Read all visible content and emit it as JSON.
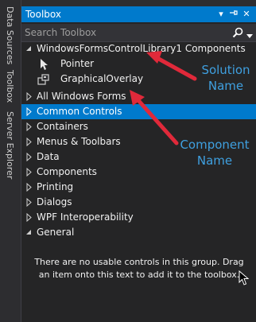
{
  "side_tabs": [
    "Data Sources",
    "Toolbox",
    "Server Explorer"
  ],
  "toolbox": {
    "title": "Toolbox",
    "search_placeholder": "Search Toolbox",
    "groups": [
      {
        "label": "WindowsFormsControlLibrary1 Components",
        "expanded": true
      },
      {
        "label": "All Windows Forms",
        "expanded": false
      },
      {
        "label": "Common Controls",
        "expanded": false,
        "selected": true
      },
      {
        "label": "Containers",
        "expanded": false
      },
      {
        "label": "Menus & Toolbars",
        "expanded": false
      },
      {
        "label": "Data",
        "expanded": false
      },
      {
        "label": "Components",
        "expanded": false
      },
      {
        "label": "Printing",
        "expanded": false
      },
      {
        "label": "Dialogs",
        "expanded": false
      },
      {
        "label": "WPF Interoperability",
        "expanded": false
      },
      {
        "label": "General",
        "expanded": true
      }
    ],
    "items": [
      {
        "label": "Pointer",
        "icon": "pointer-arrow-icon"
      },
      {
        "label": "GraphicalOverlay",
        "icon": "component-icon"
      }
    ],
    "empty_message": "There are no usable controls in this group. Drag an item onto this text to add it to the toolbox."
  },
  "annotations": {
    "solution_name": [
      "Solution",
      "Name"
    ],
    "component_name": [
      "Component",
      "Name"
    ],
    "arrow_color": "#e0293a",
    "text_color": "#3fa0e0"
  },
  "colors": {
    "accent": "#007acc",
    "panel_bg": "#252526",
    "chrome_bg": "#2d2d30"
  }
}
